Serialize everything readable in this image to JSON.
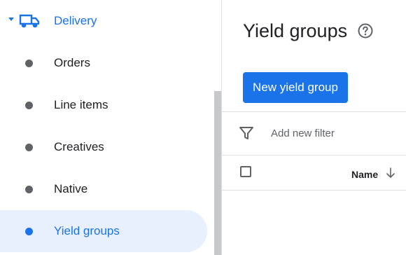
{
  "sidebar": {
    "parent": {
      "label": "Delivery",
      "icon": "truck-icon",
      "expanded": true
    },
    "items": [
      {
        "label": "Orders",
        "active": false
      },
      {
        "label": "Line items",
        "active": false
      },
      {
        "label": "Creatives",
        "active": false
      },
      {
        "label": "Native",
        "active": false
      },
      {
        "label": "Yield groups",
        "active": true
      }
    ]
  },
  "main": {
    "title": "Yield groups",
    "help_icon": "help-circle-icon",
    "new_button_label": "New yield group",
    "filter": {
      "icon": "filter-icon",
      "placeholder": "Add new filter"
    },
    "table": {
      "columns": [
        {
          "label": "Name",
          "sort": "descending"
        }
      ]
    }
  },
  "colors": {
    "accent": "#1a73e8",
    "active_bg": "#e8f0fe",
    "text": "#202124",
    "muted": "#5f6368"
  }
}
